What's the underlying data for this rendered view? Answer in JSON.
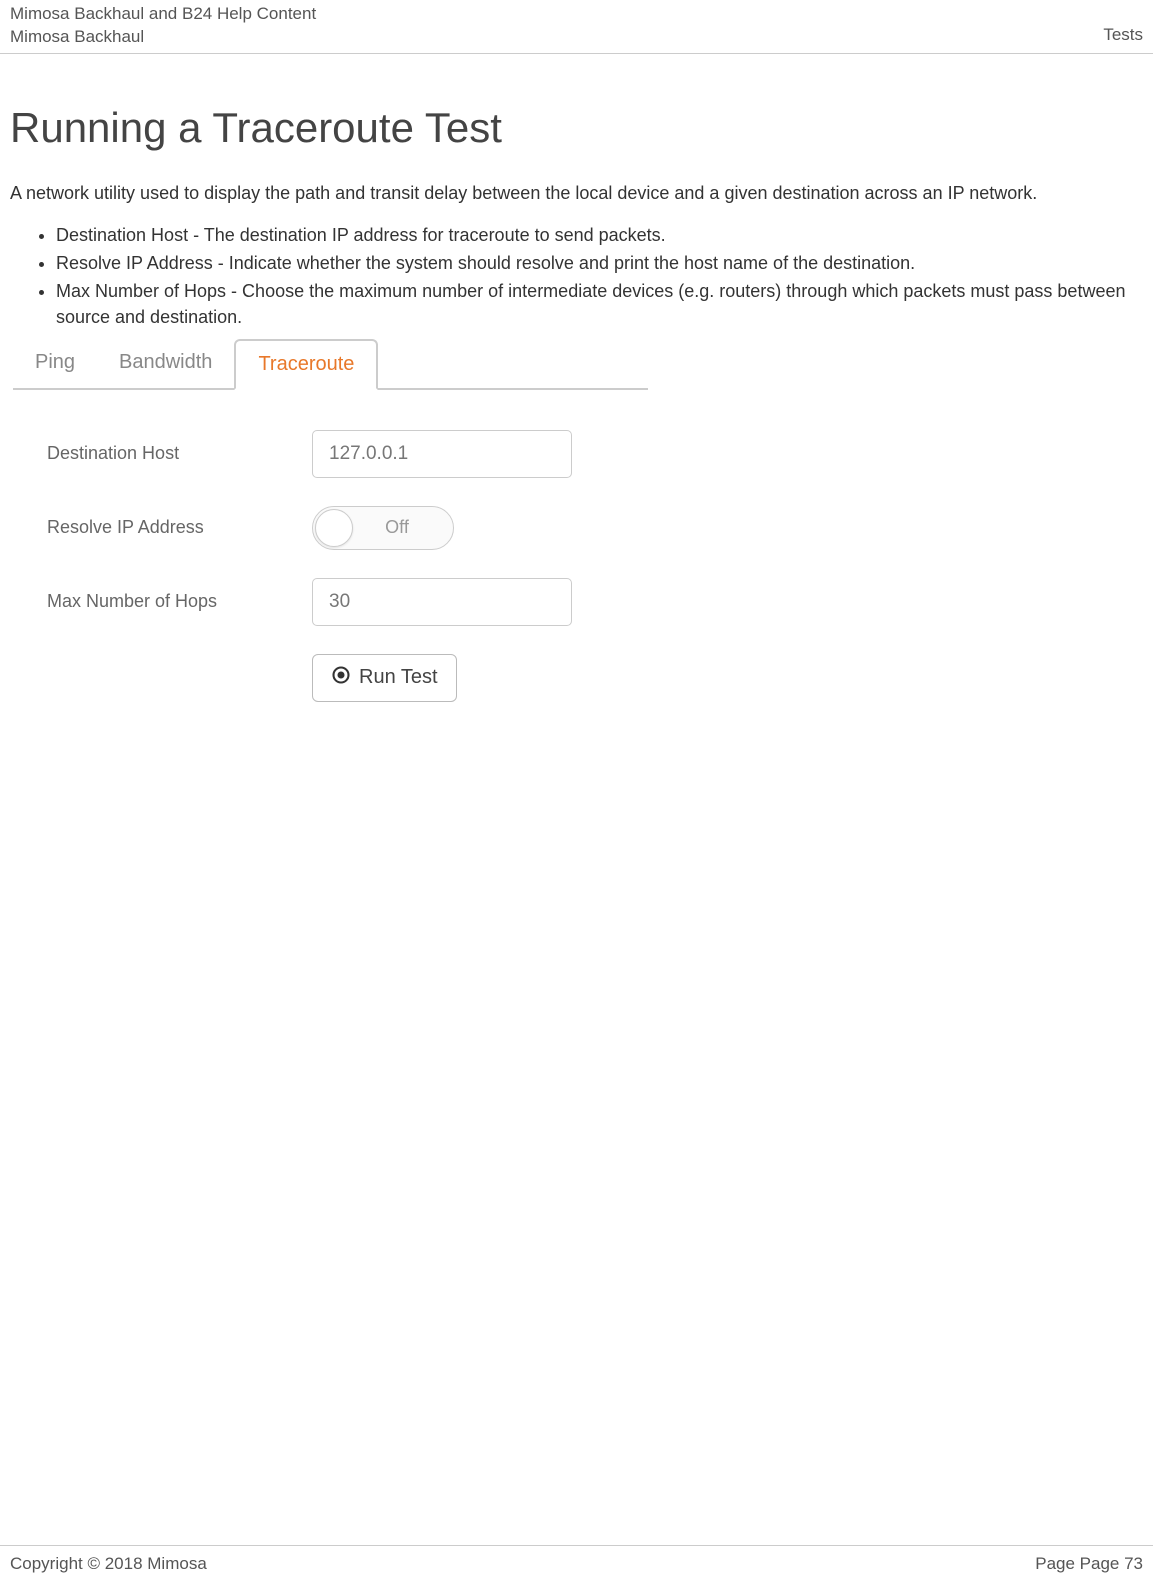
{
  "header": {
    "title_line1": "Mimosa Backhaul and B24 Help Content",
    "title_line2": "Mimosa Backhaul",
    "section": "Tests"
  },
  "page": {
    "heading": "Running a Traceroute Test",
    "intro": "A network utility used to display the path and transit delay between the local device and a given destination across an IP network.",
    "bullets": [
      "Destination Host - The destination IP address for traceroute to send packets.",
      "Resolve IP Address - Indicate whether the system should resolve and print the host name of the destination.",
      "Max Number of Hops - Choose the maximum number of intermediate devices (e.g. routers) through which packets must pass between source and destination."
    ]
  },
  "tabs": {
    "items": [
      {
        "label": "Ping",
        "active": false
      },
      {
        "label": "Bandwidth",
        "active": false
      },
      {
        "label": "Traceroute",
        "active": true
      }
    ]
  },
  "form": {
    "destination_host": {
      "label": "Destination Host",
      "value": "127.0.0.1"
    },
    "resolve_ip": {
      "label": "Resolve IP Address",
      "value": "Off"
    },
    "max_hops": {
      "label": "Max Number of Hops",
      "value": "30"
    },
    "run_button": "Run Test"
  },
  "footer": {
    "copyright": "Copyright © 2018 Mimosa",
    "page": "Page Page 73"
  }
}
